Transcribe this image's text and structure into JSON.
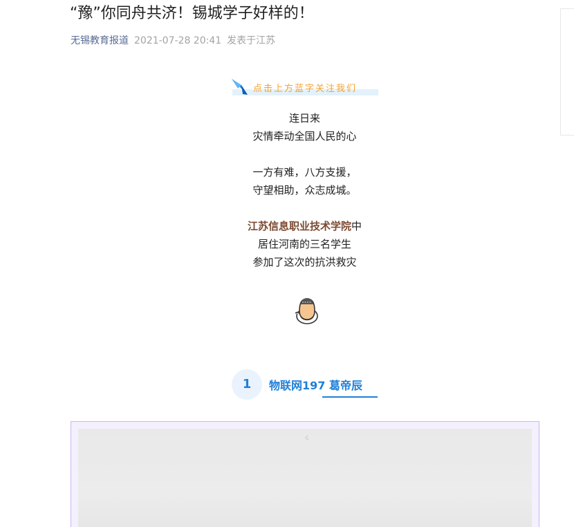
{
  "article": {
    "title": "“豫”你同舟共济！锡城学子好样的！",
    "author": "无锡教育报道",
    "date": "2021-07-28 20:41",
    "location": "发表于江苏"
  },
  "follow_banner": {
    "text": "点击上方蓝字关注我们"
  },
  "body": {
    "lines_1": [
      "连日来",
      "灾情牵动全国人民的心"
    ],
    "lines_2": [
      "一方有难，八方支援，",
      "守望相助，众志成城。"
    ],
    "highlight_school": "江苏信息职业技术学院",
    "highlight_suffix": "中",
    "lines_3": [
      "居住河南的三名学生",
      "参加了这次的抗洪救灾"
    ]
  },
  "section": {
    "number": "1",
    "name": "物联网197 葛帝辰"
  },
  "colors": {
    "author_link": "#576b95",
    "follow_text": "#f0a436",
    "accent_blue": "#1f7fd8",
    "highlight": "#7d4a32",
    "frame_border": "#c7b7ee"
  },
  "icons": {
    "banner": "paper-plane-icon",
    "emoji": "pointing-hand-emoji-icon"
  }
}
